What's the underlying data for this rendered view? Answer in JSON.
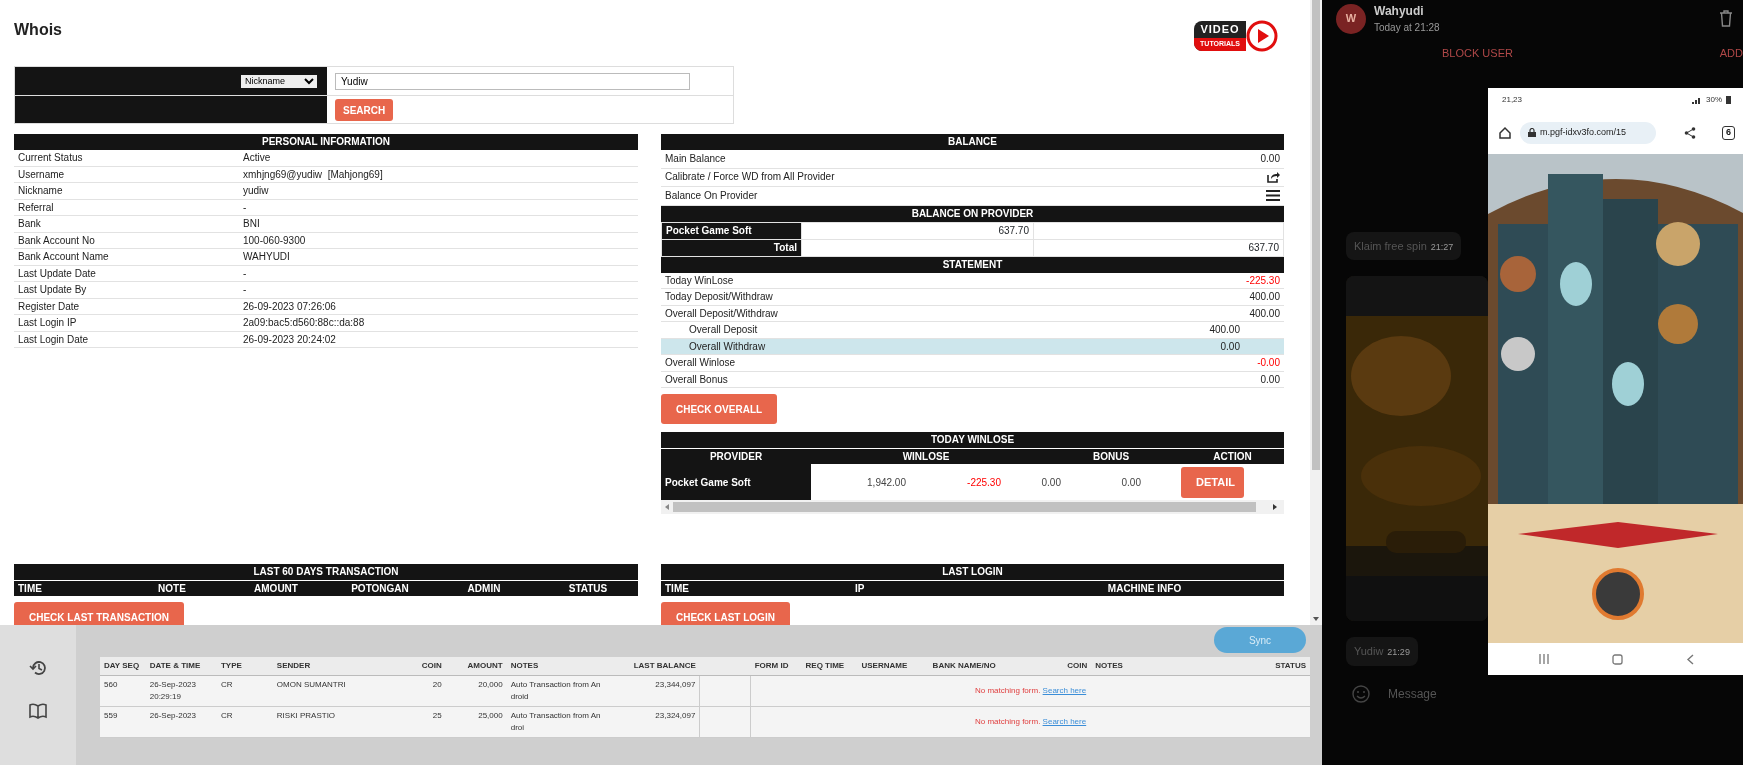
{
  "whois": {
    "title": "Whois",
    "video_badge": {
      "line1": "VIDEO",
      "line2": "TUTORIALS"
    },
    "search": {
      "type": "Nickname",
      "value": "Yudiw",
      "button": "SEARCH"
    },
    "personal_information": {
      "title": "PERSONAL INFORMATION",
      "rows": [
        {
          "label": "Current Status",
          "value": "Active"
        },
        {
          "label": "Username",
          "value": "xmhjng69@yudiw  [Mahjong69]"
        },
        {
          "label": "Nickname",
          "value": "yudiw"
        },
        {
          "label": "Referral",
          "value": "-"
        },
        {
          "label": "Bank",
          "value": "BNI"
        },
        {
          "label": "Bank Account No",
          "value": "100-060-9300"
        },
        {
          "label": "Bank Account Name",
          "value": "WAHYUDI"
        },
        {
          "label": "Last Update Date",
          "value": "-"
        },
        {
          "label": "Last Update By",
          "value": "-"
        },
        {
          "label": "Register Date",
          "value": "26-09-2023 07:26:06"
        },
        {
          "label": "Last Login IP",
          "value": "2a09:bac5:d560:88c::da:88"
        },
        {
          "label": "Last Login Date",
          "value": "26-09-2023 20:24:02"
        }
      ]
    },
    "balance": {
      "title": "BALANCE",
      "rows": [
        {
          "kind": "value",
          "label": "Main Balance",
          "value": "0.00"
        },
        {
          "kind": "action",
          "label": "Calibrate / Force WD from All Provider"
        },
        {
          "kind": "list",
          "label": "Balance On Provider"
        }
      ]
    },
    "balance_on_provider": {
      "title": "BALANCE ON PROVIDER",
      "rows": [
        {
          "name": "Pocket Game Soft",
          "amount": "637.70"
        }
      ],
      "total_label": "Total",
      "total": "637.70"
    },
    "statement": {
      "title": "STATEMENT",
      "rows": [
        {
          "label": "Today WinLose",
          "value": "-225.30",
          "negative": true,
          "sub": false,
          "highlighted": false
        },
        {
          "label": "Today Deposit/Withdraw",
          "value": "400.00",
          "negative": false,
          "sub": false,
          "highlighted": false
        },
        {
          "label": "Overall Deposit/Withdraw",
          "value": "400.00",
          "negative": false,
          "sub": false,
          "highlighted": false
        },
        {
          "label": "Overall Deposit",
          "value": "400.00",
          "negative": false,
          "sub": true,
          "highlighted": false
        },
        {
          "label": "Overall Withdraw",
          "value": "0.00",
          "negative": false,
          "sub": true,
          "highlighted": true
        },
        {
          "label": "Overall Winlose",
          "value": "-0.00",
          "negative": true,
          "sub": false,
          "highlighted": false
        },
        {
          "label": "Overall Bonus",
          "value": "0.00",
          "negative": false,
          "sub": false,
          "highlighted": false
        }
      ],
      "button": "CHECK OVERALL"
    },
    "today_winlose": {
      "title": "TODAY WINLOSE",
      "columns": [
        "PROVIDER",
        "WINLOSE",
        "BONUS",
        "ACTION"
      ],
      "rows": [
        {
          "provider": "Pocket Game Soft",
          "values": [
            {
              "text": "1,942.00",
              "negative": false
            },
            {
              "text": "-225.30",
              "negative": true
            },
            {
              "text": "0.00",
              "negative": false
            },
            {
              "text": "0.00",
              "negative": false
            }
          ],
          "action": "DETAIL"
        }
      ]
    },
    "last_60_days": {
      "title": "LAST 60 DAYS TRANSACTION",
      "columns": [
        "TIME",
        "NOTE",
        "AMOUNT",
        "POTONGAN",
        "ADMIN",
        "STATUS"
      ],
      "button": "CHECK LAST TRANSACTION"
    },
    "last_login": {
      "title": "LAST LOGIN",
      "columns": [
        "TIME",
        "IP",
        "MACHINE INFO"
      ],
      "button": "CHECK LAST LOGIN"
    }
  },
  "background_page": {
    "sync_button": "Sync",
    "columns": [
      "DAY SEQ",
      "DATE & TIME",
      "TYPE",
      "SENDER",
      "COIN",
      "AMOUNT",
      "NOTES",
      "LAST BALANCE",
      "FORM ID",
      "REQ TIME",
      "USERNAME",
      "BANK NAME/NO",
      "COIN",
      "NOTES",
      "STATUS"
    ],
    "rows": [
      {
        "cells": [
          "560",
          "26-Sep-2023 20:29:19",
          "CR",
          "OMON SUMANTRI",
          "20",
          "20,000",
          "Auto Transaction from Android",
          "23,344,097"
        ],
        "match": "No matching form.",
        "link": "Search here"
      },
      {
        "cells": [
          "559",
          "26-Sep-2023",
          "CR",
          "RISKI PRASTIO",
          "25",
          "25,000",
          "Auto Transaction from Androi",
          "23,324,097"
        ],
        "match": "No matching form.",
        "link": "Search here"
      }
    ]
  },
  "chat": {
    "avatar": "W",
    "name": "Wahyudi",
    "time": "Today at 21:28",
    "block": "BLOCK USER",
    "add": "ADD",
    "messages": [
      {
        "text": "Klaim free spin",
        "time": "21:27",
        "kind": "text"
      },
      {
        "kind": "picture"
      },
      {
        "text": "Yudiw",
        "time": "21:29",
        "kind": "text"
      }
    ],
    "composer": {
      "placeholder": "Message"
    },
    "phone": {
      "clock": "21,23",
      "battery": "30%",
      "url": "m.pgf-idxv3fo.com/15",
      "tabs": "6"
    }
  }
}
